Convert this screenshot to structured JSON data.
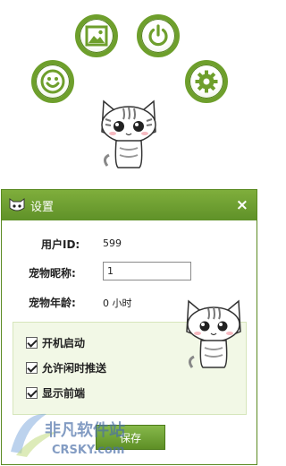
{
  "launcher": {
    "icons": [
      "emoji-icon",
      "image-icon",
      "power-icon",
      "gear-icon"
    ]
  },
  "window": {
    "title": "设置",
    "close_glyph": "×"
  },
  "fields": {
    "user_id_label": "用户ID:",
    "user_id_value": "599",
    "nickname_label": "宠物昵称:",
    "nickname_value": "1",
    "age_label": "宠物年龄:",
    "age_value": "0 小时"
  },
  "options": [
    {
      "label": "开机启动",
      "checked": true
    },
    {
      "label": "允许闲时推送",
      "checked": true
    },
    {
      "label": "显示前端",
      "checked": true
    }
  ],
  "save_label": "保存",
  "watermark": {
    "text_cn": "非凡软件站",
    "text_en": "CRSKY.com"
  },
  "colors": {
    "accent": "#6e9f2c",
    "titlebar": "#6b9d30",
    "panel": "#f2f8e6"
  }
}
